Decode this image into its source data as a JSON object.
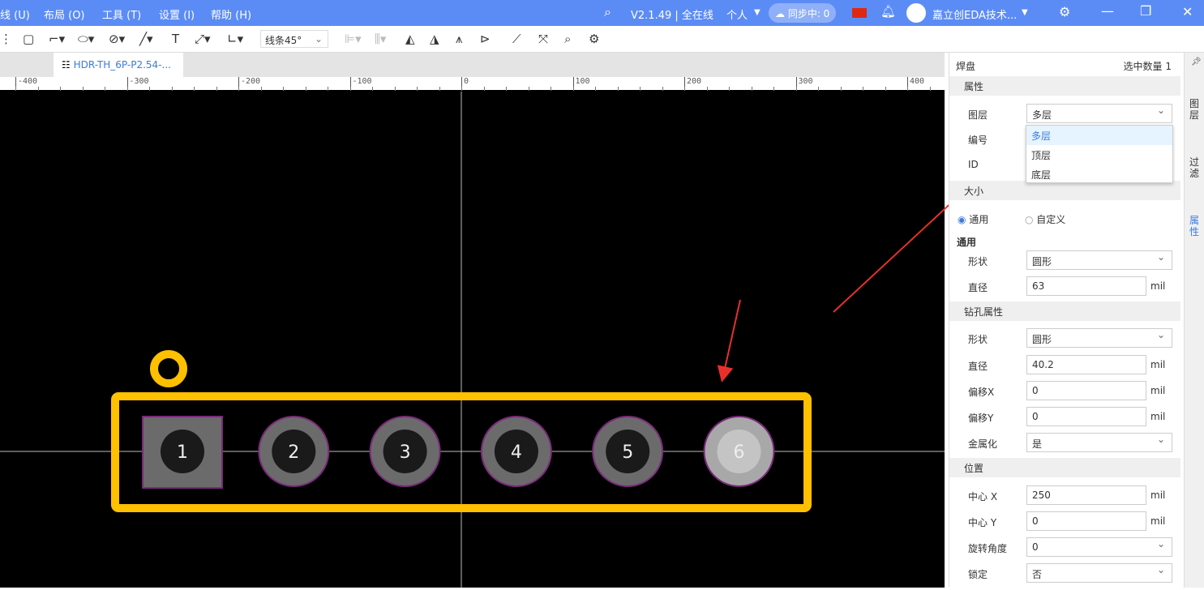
{
  "menu": {
    "items": [
      "线 (U)",
      "布局 (O)",
      "工具 (T)",
      "设置 (I)",
      "帮助 (H)"
    ],
    "version": "V2.1.49 | 全在线",
    "account_type": "个人",
    "sync": "同步中: 0",
    "user": "嘉立创EDA技术..."
  },
  "toolbar": {
    "line_mode": "线条45°"
  },
  "tab": {
    "title": "HDR-TH_6P-P2.54-..."
  },
  "ruler": {
    "ticks": [
      "-400",
      "-300",
      "-200",
      "-100",
      "0",
      "100",
      "200",
      "300",
      "400"
    ]
  },
  "pads": [
    "1",
    "2",
    "3",
    "4",
    "5",
    "6"
  ],
  "panel": {
    "title": "焊盘",
    "selected_count": "选中数量 1",
    "sections": {
      "attr": "属性",
      "size": "大小",
      "drill": "钻孔属性",
      "position": "位置"
    },
    "layer_label": "图层",
    "layer_value": "多层",
    "number_label": "编号",
    "id_label": "ID",
    "layer_options": [
      "多层",
      "顶层",
      "底层"
    ],
    "radio_general": "通用",
    "radio_custom": "自定义",
    "general_heading": "通用",
    "shape_label": "形状",
    "shape_value": "圆形",
    "diameter_label": "直径",
    "diameter_value": "63",
    "drill_shape_label": "形状",
    "drill_shape_value": "圆形",
    "drill_diameter_label": "直径",
    "drill_diameter_value": "40.2",
    "offset_x_label": "偏移X",
    "offset_x_value": "0",
    "offset_y_label": "偏移Y",
    "offset_y_value": "0",
    "plated_label": "金属化",
    "plated_value": "是",
    "center_x_label": "中心 X",
    "center_x_value": "250",
    "center_y_label": "中心 Y",
    "center_y_value": "0",
    "rotation_label": "旋转角度",
    "rotation_value": "0",
    "lock_label": "锁定",
    "lock_value": "否",
    "unit": "mil"
  },
  "side_tabs": [
    "图层",
    "过滤",
    "属性"
  ],
  "colors": {
    "title": "#5b8cf6",
    "outline": "#ffc000",
    "arrow": "#e8302a",
    "accent": "#3a7be0"
  }
}
